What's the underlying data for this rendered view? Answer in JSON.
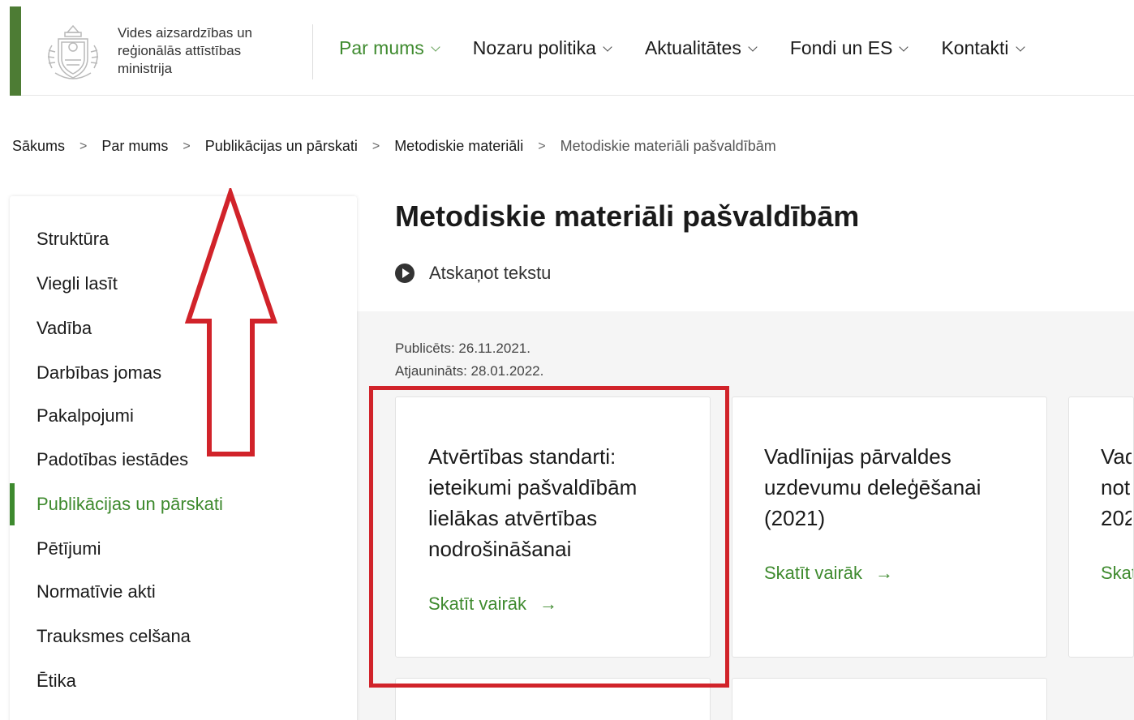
{
  "header": {
    "ministry_name": "Vides aizsardzības un reģionālās attīstības ministrija",
    "nav": [
      {
        "label": "Par mums",
        "active": true
      },
      {
        "label": "Nozaru politika",
        "active": false
      },
      {
        "label": "Aktualitātes",
        "active": false
      },
      {
        "label": "Fondi un ES",
        "active": false
      },
      {
        "label": "Kontakti",
        "active": false
      }
    ]
  },
  "breadcrumb": [
    "Sākums",
    "Par mums",
    "Publikācijas un pārskati",
    "Metodiskie materiāli",
    "Metodiskie materiāli pašvaldībām"
  ],
  "sidebar": {
    "items": [
      {
        "label": "Struktūra"
      },
      {
        "label": "Viegli lasīt"
      },
      {
        "label": "Vadība"
      },
      {
        "label": "Darbības jomas"
      },
      {
        "label": "Pakalpojumi"
      },
      {
        "label": "Padotības iestādes"
      },
      {
        "label": "Publikācijas un pārskati",
        "active": true
      },
      {
        "label": "Pētījumi"
      },
      {
        "label": "Normatīvie akti"
      },
      {
        "label": "Trauksmes celšana"
      },
      {
        "label": "Ētika"
      }
    ]
  },
  "main": {
    "title": "Metodiskie materiāli pašvaldībām",
    "listen_label": "Atskaņot tekstu",
    "published": "Publicēts: 26.11.2021.",
    "updated": "Atjaunināts: 28.01.2022.",
    "cards": [
      {
        "title": "Atvērtības standarti: ieteikumi pašvaldībām lielākas atvērtības nodrošināšanai",
        "link": "Skatīt vairāk"
      },
      {
        "title": "Vadlīnijas pārvaldes uzdevumu deleģēšanai (2021)",
        "link": "Skatīt vairāk"
      },
      {
        "title": "Vad not 202",
        "link": "Skat"
      }
    ],
    "arrow_glyph": "→"
  },
  "colors": {
    "accent_green": "#3e8a2e",
    "header_stripe": "#4d7c34",
    "annotation_red": "#d1232a"
  }
}
